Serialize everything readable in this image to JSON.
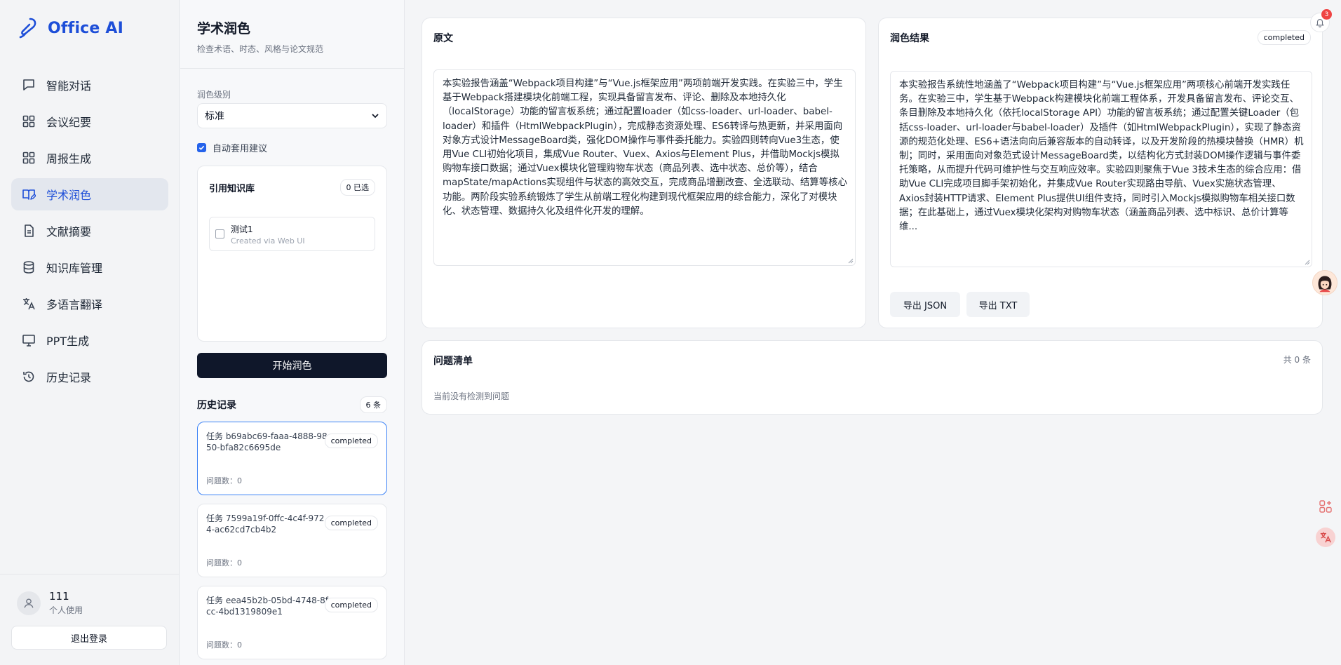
{
  "app": {
    "name": "Office AI",
    "accent": "#1d4ed8"
  },
  "nav": [
    {
      "label": "智能对话",
      "icon": "chat-icon"
    },
    {
      "label": "会议纪要",
      "icon": "grid-icon"
    },
    {
      "label": "周报生成",
      "icon": "grid-icon"
    },
    {
      "label": "学术润色",
      "icon": "book-edit-icon",
      "active": true
    },
    {
      "label": "文献摘要",
      "icon": "document-icon"
    },
    {
      "label": "知识库管理",
      "icon": "database-icon"
    },
    {
      "label": "多语言翻译",
      "icon": "translate-icon"
    },
    {
      "label": "PPT生成",
      "icon": "presentation-icon"
    },
    {
      "label": "历史记录",
      "icon": "history-icon"
    }
  ],
  "user": {
    "name": "111",
    "role": "个人使用",
    "logout": "退出登录"
  },
  "settings": {
    "title": "学术润色",
    "subtitle": "检查术语、时态、风格与论文规范",
    "level_label": "润色级别",
    "level_value": "标准",
    "auto_apply_label": "自动套用建议",
    "auto_apply_checked": true,
    "kb": {
      "title": "引用知识库",
      "selected": "0 已选",
      "items": [
        {
          "name": "测试1",
          "sub": "Created via Web UI"
        }
      ]
    },
    "start_button": "开始润色"
  },
  "history": {
    "title": "历史记录",
    "count": "6 条",
    "items": [
      {
        "task": "任务 b69abc69-faaa-4888-9850-bfa82c6695de",
        "status": "completed",
        "issues": "问题数：0",
        "selected": true
      },
      {
        "task": "任务 7599a19f-0ffc-4c4f-9724-ac62cd7cb4b2",
        "status": "completed",
        "issues": "问题数：0"
      },
      {
        "task": "任务 eea45b2b-05bd-4748-8fcc-4bd1319809e1",
        "status": "completed",
        "issues": "问题数：0"
      }
    ]
  },
  "original": {
    "title": "原文",
    "text": "本实验报告涵盖“Webpack项目构建”与“Vue.js框架应用”两项前端开发实践。在实验三中，学生基于Webpack搭建模块化前端工程，实现具备留言发布、评论、删除及本地持久化（localStorage）功能的留言板系统；通过配置loader（如css-loader、url-loader、babel-loader）和插件（HtmlWebpackPlugin），完成静态资源处理、ES6转译与热更新，并采用面向对象方式设计MessageBoard类，强化DOM操作与事件委托能力。实验四则转向Vue3生态，使用Vue CLI初始化项目，集成Vue Router、Vuex、Axios与Element Plus，并借助Mockjs模拟购物车接口数据；通过Vuex模块化管理购物车状态（商品列表、选中状态、总价等），结合mapState/mapActions实现组件与状态的高效交互，完成商品增删改查、全选联动、结算等核心功能。两阶段实验系统锻炼了学生从前端工程化构建到现代框架应用的综合能力，深化了对模块化、状态管理、数据持久化及组件化开发的理解。"
  },
  "result": {
    "title": "润色结果",
    "status": "completed",
    "text": "本实验报告系统性地涵盖了“Webpack项目构建”与“Vue.js框架应用”两项核心前端开发实践任务。在实验三中，学生基于Webpack构建模块化前端工程体系，开发具备留言发布、评论交互、条目删除及本地持久化（依托localStorage API）功能的留言板系统；通过配置关键Loader（包括css-loader、url-loader与babel-loader）及插件（如HtmlWebpackPlugin），实现了静态资源的规范化处理、ES6+语法向向后兼容版本的自动转译，以及开发阶段的热模块替换（HMR）机制；同时，采用面向对象范式设计MessageBoard类，以结构化方式封装DOM操作逻辑与事件委托策略，从而提升代码可维护性与交互响应效率。实验四则聚焦于Vue 3技术生态的综合应用：借助Vue CLI完成项目脚手架初始化，并集成Vue Router实现路由导航、Vuex实施状态管理、Axios封装HTTP请求、Element Plus提供UI组件支持，同时引入Mockjs模拟购物车相关接口数据；在此基础上，通过Vuex模块化架构对购物车状态（涵盖商品列表、选中标识、总价计算等维...",
    "export_json": "导出 JSON",
    "export_txt": "导出 TXT"
  },
  "issues": {
    "title": "问题清单",
    "count": "共 0 条",
    "empty": "当前没有检测到问题"
  },
  "notifications": {
    "count": "3"
  }
}
